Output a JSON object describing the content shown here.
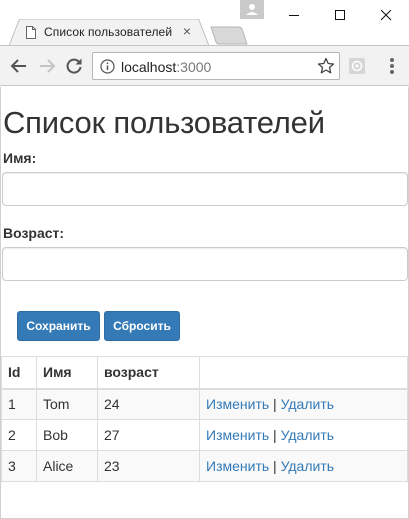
{
  "browser": {
    "tab_title": "Список пользователей",
    "url_host": "localhost",
    "url_port": ":3000"
  },
  "page": {
    "title": "Список пользователей",
    "name_label": "Имя:",
    "name_value": "",
    "age_label": "Возраст:",
    "age_value": "",
    "save_button": "Сохранить",
    "reset_button": "Сбросить"
  },
  "table": {
    "headers": [
      "Id",
      "Имя",
      "возраст",
      ""
    ],
    "rows": [
      {
        "id": "1",
        "name": "Tom",
        "age": "24"
      },
      {
        "id": "2",
        "name": "Bob",
        "age": "27"
      },
      {
        "id": "3",
        "name": "Alice",
        "age": "23"
      }
    ],
    "edit_link": "Изменить",
    "separator": "|",
    "delete_link": "Удалить"
  },
  "colors": {
    "primary": "#337ab7",
    "primary_border": "#2e6da4",
    "link": "#337ab7",
    "striped_row": "#f9f9f9",
    "table_border": "#dddddd"
  },
  "icons": {
    "tab": "document-icon",
    "back": "back-arrow-icon",
    "forward": "forward-arrow-icon",
    "reload": "reload-icon",
    "info": "info-icon",
    "bookmark": "star-icon",
    "extension": "extension-icon",
    "menu": "kebab-menu-icon"
  }
}
